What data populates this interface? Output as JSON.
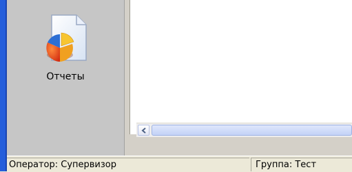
{
  "sidebar": {
    "items": [
      {
        "label": "Отчеты",
        "icon": "reports-icon"
      }
    ]
  },
  "statusbar": {
    "operator": "Оператор: Супервизор",
    "group": "Группа: Тест"
  },
  "colors": {
    "window_border": "#245edb",
    "sidebar_bg": "#c6c6c6",
    "statusbar_bg": "#ece9d8"
  }
}
